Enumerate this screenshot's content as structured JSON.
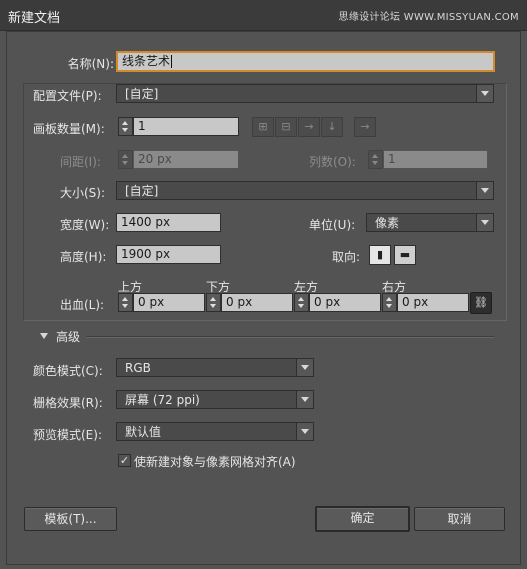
{
  "window": {
    "title": "新建文档",
    "watermark": "思缘设计论坛 WWW.MISSYUAN.COM"
  },
  "name": {
    "label": "名称(N):",
    "value": "线条艺术"
  },
  "profile": {
    "label": "配置文件(P):",
    "value": "[自定]"
  },
  "artboards": {
    "count_label": "画板数量(M):",
    "count_value": "1",
    "layout_icons": [
      "grid-by-row-icon",
      "grid-by-column-icon",
      "arrange-by-row-icon",
      "arrange-by-column-icon",
      "right-to-left-icon"
    ],
    "spacing_label": "间距(I):",
    "spacing_value": "20 px",
    "columns_label": "列数(O):",
    "columns_value": "1"
  },
  "size": {
    "label": "大小(S):",
    "value": "[自定]"
  },
  "width": {
    "label": "宽度(W):",
    "value": "1400 px"
  },
  "units": {
    "label": "单位(U):",
    "value": "像素"
  },
  "height": {
    "label": "高度(H):",
    "value": "1900 px"
  },
  "orientation": {
    "label": "取向:",
    "portrait_icon": "portrait-icon",
    "landscape_icon": "landscape-icon",
    "selected": "portrait"
  },
  "bleed": {
    "label": "出血(L):",
    "top_label": "上方",
    "top_value": "0 px",
    "bottom_label": "下方",
    "bottom_value": "0 px",
    "left_label": "左方",
    "left_value": "0 px",
    "right_label": "右方",
    "right_value": "0 px",
    "link_icon": "chain-link-icon"
  },
  "advanced": {
    "label": "高级",
    "color_mode_label": "颜色模式(C):",
    "color_mode_value": "RGB",
    "raster_label": "栅格效果(R):",
    "raster_value": "屏幕 (72 ppi)",
    "preview_label": "预览模式(E):",
    "preview_value": "默认值",
    "align_checkbox_label": "使新建对象与像素网格对齐(A)",
    "align_checked": true
  },
  "buttons": {
    "templates": "模板(T)...",
    "ok": "确定",
    "cancel": "取消"
  },
  "colors": {
    "dialog_bg": "#535353",
    "focus_outline": "#d48a2a",
    "field_bg": "#c8c8c8"
  }
}
